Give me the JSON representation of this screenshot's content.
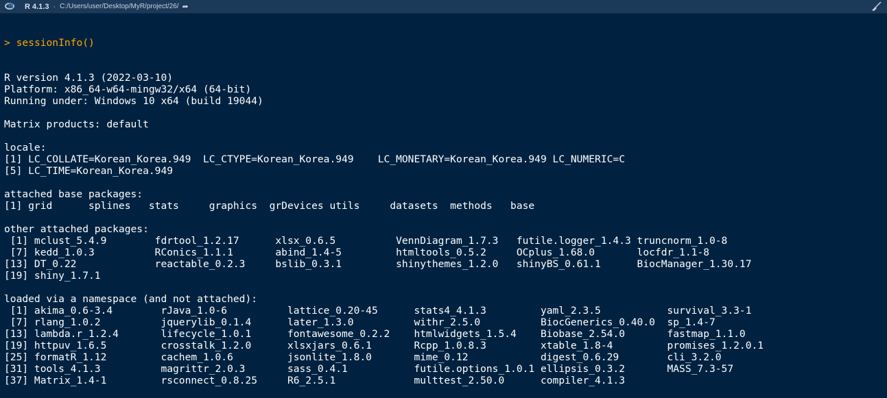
{
  "titlebar": {
    "r_version": "R 4.1.3",
    "separator": "·",
    "path": "C:/Users/user/Desktop/MyR/project/26/",
    "icons": [
      "r-logo-icon",
      "go-to-directory-icon",
      "clear-console-broom-icon"
    ]
  },
  "console": {
    "prompt": ">",
    "command": "sessionInfo()",
    "output_lines": [
      "R version 4.1.3 (2022-03-10)",
      "Platform: x86_64-w64-mingw32/x64 (64-bit)",
      "Running under: Windows 10 x64 (build 19044)",
      "",
      "Matrix products: default",
      "",
      "locale:",
      "[1] LC_COLLATE=Korean_Korea.949  LC_CTYPE=Korean_Korea.949    LC_MONETARY=Korean_Korea.949 LC_NUMERIC=C",
      "[5] LC_TIME=Korean_Korea.949",
      "",
      "attached base packages:",
      "[1] grid      splines   stats     graphics  grDevices utils     datasets  methods   base",
      "",
      "other attached packages:",
      " [1] mclust_5.4.9        fdrtool_1.2.17      xlsx_0.6.5          VennDiagram_1.7.3   futile.logger_1.4.3 truncnorm_1.0-8",
      " [7] kedd_1.0.3          RConics_1.1.1       abind_1.4-5         htmltools_0.5.2     OCplus_1.68.0       locfdr_1.1-8",
      "[13] DT_0.22             reactable_0.2.3     bslib_0.3.1         shinythemes_1.2.0   shinyBS_0.61.1      BiocManager_1.30.17",
      "[19] shiny_1.7.1",
      "",
      "loaded via a namespace (and not attached):",
      " [1] akima_0.6-3.4        rJava_1.0-6          lattice_0.20-45      stats4_4.1.3         yaml_2.3.5           survival_3.3-1",
      " [7] rlang_1.0.2          jquerylib_0.1.4      later_1.3.0          withr_2.5.0          BiocGenerics_0.40.0  sp_1.4-7",
      "[13] lambda.r_1.2.4       lifecycle_1.0.1      fontawesome_0.2.2    htmlwidgets_1.5.4    Biobase_2.54.0       fastmap_1.1.0",
      "[19] httpuv_1.6.5         crosstalk_1.2.0      xlsxjars_0.6.1       Rcpp_1.0.8.3         xtable_1.8-4         promises_1.2.0.1",
      "[25] formatR_1.12         cachem_1.0.6         jsonlite_1.8.0       mime_0.12            digest_0.6.29        cli_3.2.0",
      "[31] tools_4.1.3          magrittr_2.0.3       sass_0.4.1           futile.options_1.0.1 ellipsis_0.3.2       MASS_7.3-57",
      "[37] Matrix_1.4-1         rsconnect_0.8.25     R6_2.5.1             multtest_2.50.0      compiler_4.1.3"
    ]
  },
  "colors": {
    "background": "#002240",
    "titlebar": "#1b3a5a",
    "prompt": "#ffa500",
    "text": "#ffffff"
  }
}
